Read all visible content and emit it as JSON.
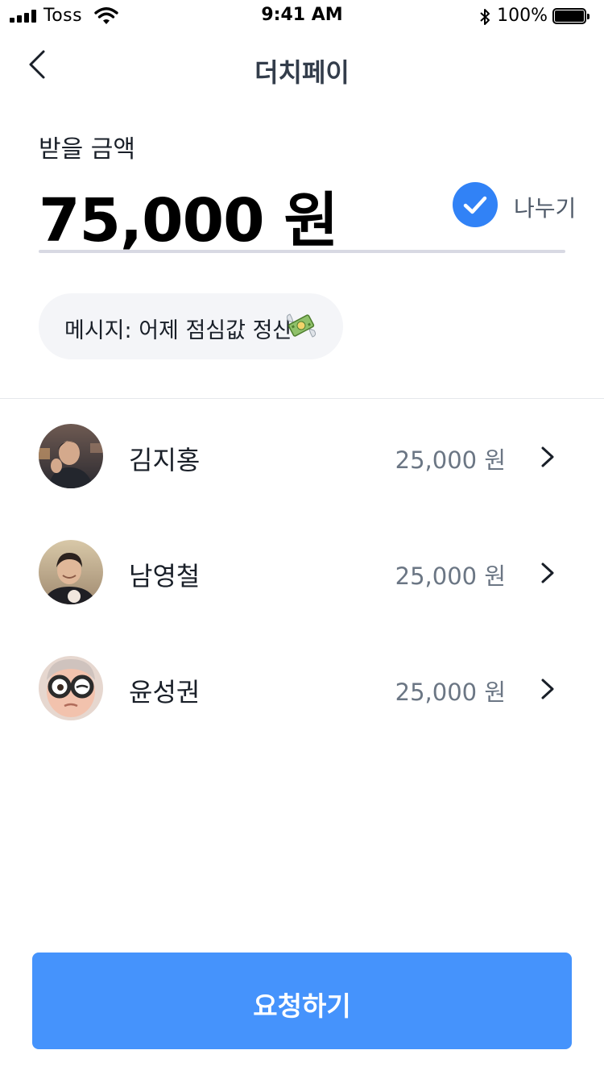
{
  "status_bar": {
    "carrier": "Toss",
    "time": "9:41 AM",
    "battery": "100%"
  },
  "nav": {
    "title": "더치페이"
  },
  "amount": {
    "label": "받을 금액",
    "value": "75,000 원",
    "split_label": "나누기",
    "split_checked": true
  },
  "message": {
    "text": "메시지: 어제 점심값 정산",
    "icon": "money-with-wings-emoji"
  },
  "participants": [
    {
      "name": "김지홍",
      "amount": "25,000 원",
      "avatar": "photo"
    },
    {
      "name": "남영철",
      "amount": "25,000 원",
      "avatar": "photo"
    },
    {
      "name": "윤성권",
      "amount": "25,000 원",
      "avatar": "memoji"
    }
  ],
  "cta": {
    "label": "요청하기"
  },
  "colors": {
    "accent": "#3182f6",
    "cta": "#4593fc",
    "text": "#191f28",
    "muted": "#6b7684",
    "chip": "#f4f5f8",
    "underline": "#d8d9e3"
  }
}
